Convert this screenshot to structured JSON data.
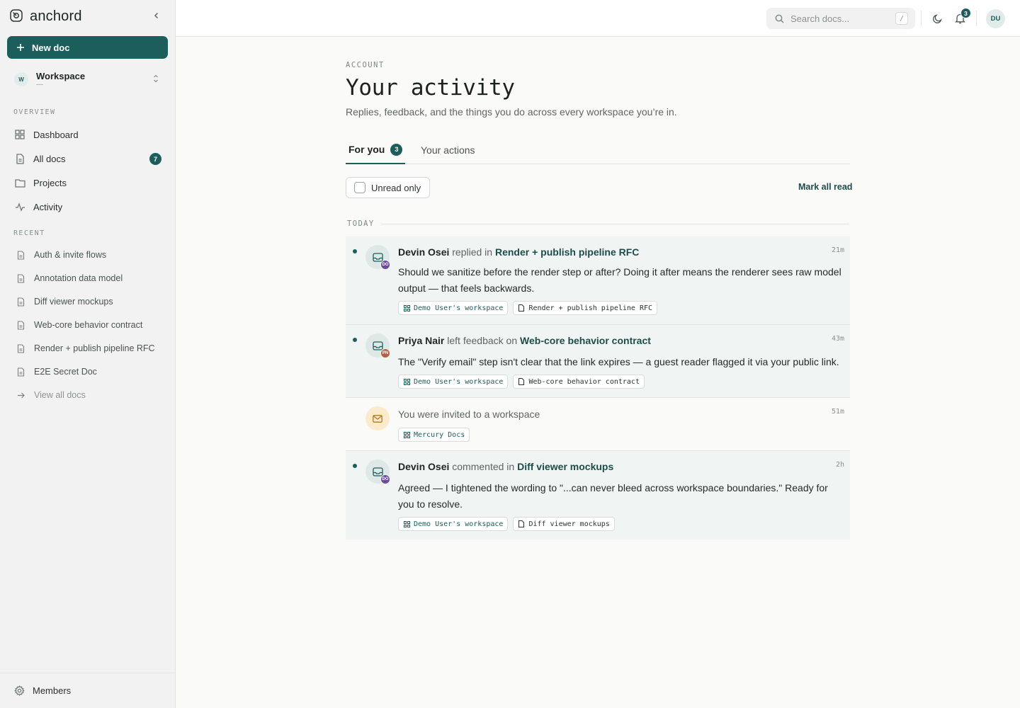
{
  "app": {
    "name": "anchord"
  },
  "sidebar": {
    "new_doc_label": "New doc",
    "workspace": {
      "initial": "W",
      "name": "Workspace",
      "sub": "—"
    },
    "overview_label": "OVERVIEW",
    "nav": [
      {
        "label": "Dashboard",
        "icon": "dashboard-icon"
      },
      {
        "label": "All docs",
        "icon": "doc-icon",
        "badge": "7"
      },
      {
        "label": "Projects",
        "icon": "folder-icon"
      },
      {
        "label": "Activity",
        "icon": "activity-icon"
      }
    ],
    "recent_label": "RECENT",
    "recent": [
      {
        "label": "Auth & invite flows"
      },
      {
        "label": "Annotation data model"
      },
      {
        "label": "Diff viewer mockups"
      },
      {
        "label": "Web-core behavior contract"
      },
      {
        "label": "Render + publish pipeline RFC"
      },
      {
        "label": "E2E Secret Doc"
      }
    ],
    "view_all_label": "View all docs",
    "members_label": "Members"
  },
  "topbar": {
    "search_placeholder": "Search docs...",
    "search_shortcut": "/",
    "notifications_count": "3",
    "user_initials": "DU"
  },
  "page": {
    "eyebrow": "ACCOUNT",
    "title": "Your activity",
    "subtitle": "Replies, feedback, and the things you do across every workspace you’re in.",
    "tabs": [
      {
        "label": "For you",
        "count": "3"
      },
      {
        "label": "Your actions"
      }
    ],
    "unread_only_label": "Unread only",
    "unread_only_checked": false,
    "mark_all_read_label": "Mark all read",
    "group_label": "TODAY"
  },
  "feed": [
    {
      "actor": "Devin Osei",
      "initials": "DO",
      "verb": "replied in",
      "doc": "Render + publish pipeline RFC",
      "time": "21m",
      "unread": true,
      "body": "Should we sanitize before the render step or after? Doing it after means the renderer sees raw model output — that feels backwards.",
      "chips": [
        {
          "label": "Demo User's workspace",
          "type": "workspace"
        },
        {
          "label": "Render + publish pipeline RFC",
          "type": "doc"
        }
      ]
    },
    {
      "actor": "Priya Nair",
      "initials": "PN",
      "verb": "left feedback on",
      "doc": "Web-core behavior contract",
      "time": "43m",
      "unread": true,
      "body": "The \"Verify email\" step isn't clear that the link expires — a guest reader flagged it via your public link.",
      "chips": [
        {
          "label": "Demo User's workspace",
          "type": "workspace"
        },
        {
          "label": "Web-core behavior contract",
          "type": "doc"
        }
      ]
    },
    {
      "text": "You were invited to a workspace",
      "time": "51m",
      "unread": false,
      "chips": [
        {
          "label": "Mercury Docs",
          "type": "workspace"
        }
      ]
    },
    {
      "actor": "Devin Osei",
      "initials": "DO",
      "verb": "commented in",
      "doc": "Diff viewer mockups",
      "time": "2h",
      "unread": true,
      "body": "Agreed — I tightened the wording to \"...can never bleed across workspace boundaries.\" Ready for you to resolve.",
      "chips": [
        {
          "label": "Demo User's workspace",
          "type": "workspace"
        },
        {
          "label": "Diff viewer mockups",
          "type": "doc"
        }
      ]
    }
  ],
  "colors": {
    "accent": "#1c5e5b",
    "devin": "#6b4aa0",
    "priya": "#b4603e"
  }
}
